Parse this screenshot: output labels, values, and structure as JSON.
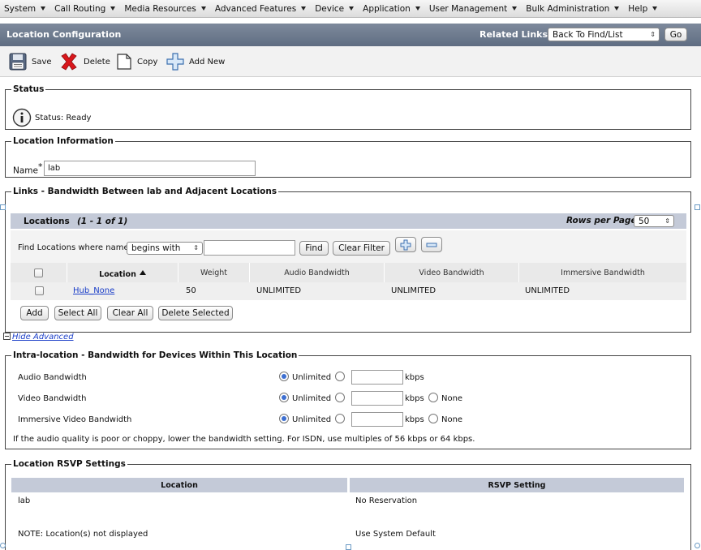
{
  "menu": [
    "System",
    "Call Routing",
    "Media Resources",
    "Advanced Features",
    "Device",
    "Application",
    "User Management",
    "Bulk Administration",
    "Help"
  ],
  "header": {
    "title": "Location Configuration",
    "related_links_label": "Related Links:",
    "related_links_value": "Back To Find/List",
    "go_label": "Go"
  },
  "toolbar": {
    "save": "Save",
    "delete": "Delete",
    "copy": "Copy",
    "add_new": "Add New"
  },
  "status": {
    "legend": "Status",
    "text": "Status: Ready"
  },
  "location_info": {
    "legend": "Location Information",
    "name_label": "Name",
    "required_mark": "*",
    "name_value": "lab"
  },
  "links": {
    "legend": "Links - Bandwidth Between lab and Adjacent Locations",
    "table_title": "Locations",
    "table_count": "(1 - 1 of 1)",
    "rows_per_page_label": "Rows per Page",
    "rows_per_page_value": "50",
    "find_label": "Find Locations where name",
    "find_op": "begins with",
    "find_value": "",
    "find_button": "Find",
    "clear_filter_button": "Clear Filter",
    "columns": [
      "Location",
      "Weight",
      "Audio Bandwidth",
      "Video Bandwidth",
      "Immersive Bandwidth"
    ],
    "rows": [
      {
        "location": "Hub_None",
        "weight": "50",
        "audio": "UNLIMITED",
        "video": "UNLIMITED",
        "immersive": "UNLIMITED"
      }
    ],
    "buttons": {
      "add": "Add",
      "select_all": "Select All",
      "clear_all": "Clear All",
      "delete_selected": "Delete Selected"
    }
  },
  "hide_advanced": "Hide Advanced",
  "intra": {
    "legend": "Intra-location - Bandwidth for Devices Within This Location",
    "audio_label": "Audio Bandwidth",
    "video_label": "Video Bandwidth",
    "immersive_label": "Immersive Video Bandwidth",
    "unlimited": "Unlimited",
    "kbps": "kbps",
    "none": "None",
    "note": "If the audio quality is poor or choppy, lower the bandwidth setting. For ISDN, use multiples of 56 kbps or 64 kbps."
  },
  "rsvp": {
    "legend": "Location RSVP Settings",
    "col_location": "Location",
    "col_setting": "RSVP Setting",
    "rows": [
      {
        "location": "lab",
        "setting": "No Reservation"
      },
      {
        "location": "NOTE: Location(s) not displayed",
        "setting": "Use System Default"
      }
    ]
  }
}
